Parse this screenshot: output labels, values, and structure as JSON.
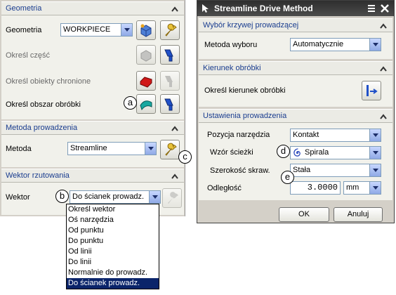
{
  "left_panel": {
    "geometria": {
      "header": "Geometria",
      "geometry_label": "Geometria",
      "geometry_value": "WORKPIECE",
      "part_label": "Określ część",
      "check_label": "Określ obiekty chronione",
      "area_label": "Określ obszar obróbki"
    },
    "metoda": {
      "header": "Metoda prowadzenia",
      "method_label": "Metoda",
      "method_value": "Streamline"
    },
    "wektor": {
      "header": "Wektor rzutowania",
      "vector_label": "Wektor",
      "vector_value": "Do ścianek prowadz.",
      "options": [
        "Określ wektor",
        "Oś narzędzia",
        "Od punktu",
        "Do punktu",
        "Od linii",
        "Do linii",
        "Normalnie do prowadz.",
        "Do ścianek prowadz."
      ]
    }
  },
  "dialog": {
    "title": "Streamline Drive Method",
    "curve_section": {
      "header": "Wybór krzywej prowadzącej",
      "method_label": "Metoda wyboru",
      "method_value": "Automatycznie"
    },
    "direction_section": {
      "header": "Kierunek obróbki",
      "label": "Określ kierunek obróbki"
    },
    "settings_section": {
      "header": "Ustawienia prowadzenia",
      "tool_pos_label": "Pozycja narzędzia",
      "tool_pos_value": "Kontakt",
      "pattern_label": "Wzór ścieżki",
      "pattern_value": "Spirala",
      "width_label": "Szerokość skraw.",
      "width_value": "Stała",
      "distance_label": "Odległość",
      "distance_value": "3.0000",
      "unit_value": "mm"
    },
    "ok_label": "OK",
    "cancel_label": "Anuluj"
  },
  "callouts": {
    "a": "a",
    "b": "b",
    "c": "c",
    "d": "d",
    "e": "e"
  },
  "colors": {
    "header_text": "#1a3d8f",
    "selection": "#0a246a",
    "title_bar": "#3a3a3a"
  }
}
